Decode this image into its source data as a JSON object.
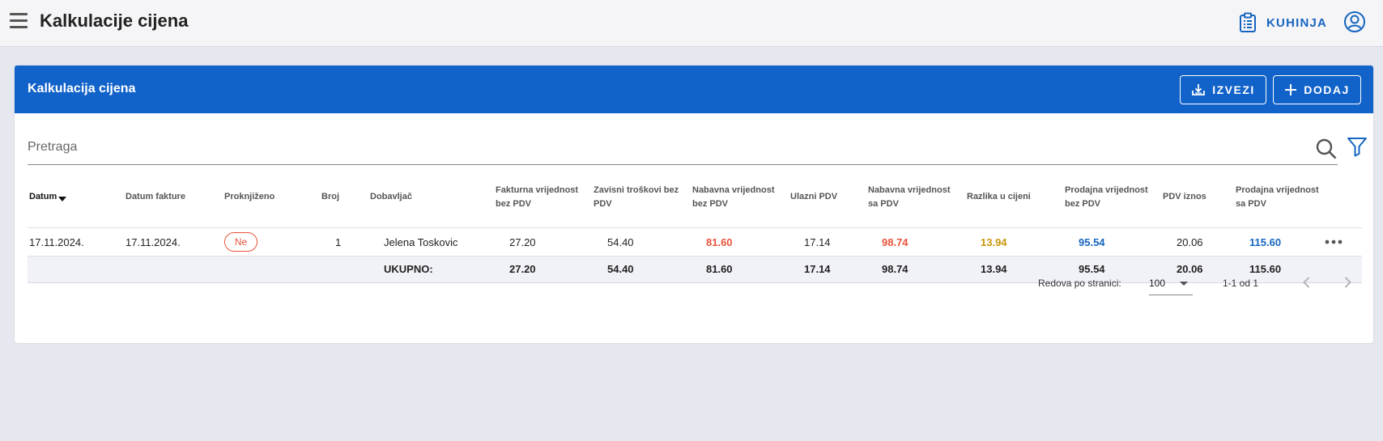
{
  "app": {
    "title": "Kalkulacije cijena",
    "kitchen_label": "KUHINJA"
  },
  "card": {
    "title": "Kalkulacija cijena",
    "export_label": "IZVEZI",
    "add_label": "DODAJ"
  },
  "search": {
    "placeholder": "Pretraga",
    "value": ""
  },
  "table": {
    "headers": [
      {
        "line1": "Datum",
        "line2": "",
        "sorted": true
      },
      {
        "line1": "Datum fakture",
        "line2": ""
      },
      {
        "line1": "Proknjiženo",
        "line2": ""
      },
      {
        "line1": "Broj",
        "line2": ""
      },
      {
        "line1": "Dobavljač",
        "line2": ""
      },
      {
        "line1": "Fakturna vrijednost",
        "line2": "bez PDV"
      },
      {
        "line1": "Zavisni troškovi bez",
        "line2": "PDV"
      },
      {
        "line1": "Nabavna vrijednost",
        "line2": "bez PDV"
      },
      {
        "line1": "Ulazni PDV",
        "line2": ""
      },
      {
        "line1": "Nabavna vrijednost",
        "line2": "sa PDV"
      },
      {
        "line1": "Razlika u cijeni",
        "line2": ""
      },
      {
        "line1": "Prodajna vrijednost",
        "line2": "bez PDV"
      },
      {
        "line1": "PDV iznos",
        "line2": ""
      },
      {
        "line1": "Prodajna vrijednost",
        "line2": "sa PDV"
      }
    ],
    "rows": [
      {
        "datum": "17.11.2024.",
        "datum_fakture": "17.11.2024.",
        "proknjizeno": "Ne",
        "broj": "1",
        "dobavljac": "Jelena Toskovic",
        "fakturna_bez_pdv": "27.20",
        "zavisni_troskovi": "54.40",
        "nabavna_bez_pdv": "81.60",
        "ulazni_pdv": "17.14",
        "nabavna_sa_pdv": "98.74",
        "razlika": "13.94",
        "prodajna_bez_pdv": "95.54",
        "pdv_iznos": "20.06",
        "prodajna_sa_pdv": "115.60"
      }
    ],
    "totals": {
      "label": "UKUPNO:",
      "fakturna_bez_pdv": "27.20",
      "zavisni_troskovi": "54.40",
      "nabavna_bez_pdv": "81.60",
      "ulazni_pdv": "17.14",
      "nabavna_sa_pdv": "98.74",
      "razlika": "13.94",
      "prodajna_bez_pdv": "95.54",
      "pdv_iznos": "20.06",
      "prodajna_sa_pdv": "115.60"
    }
  },
  "pagination": {
    "rows_per_page_label": "Redova po stranici:",
    "rows_per_page_value": "100",
    "range": "1-1 od 1"
  },
  "colors": {
    "primary": "#1162c9",
    "accent_blue": "#1565c0",
    "negative_red": "#e8533b",
    "gold": "#c9960c"
  },
  "icons": [
    "menu-icon",
    "clipboard-icon",
    "account-icon",
    "download-icon",
    "plus-icon",
    "search-icon",
    "filter-icon",
    "more-horizontal-icon",
    "chevron-left-icon",
    "chevron-right-icon"
  ]
}
